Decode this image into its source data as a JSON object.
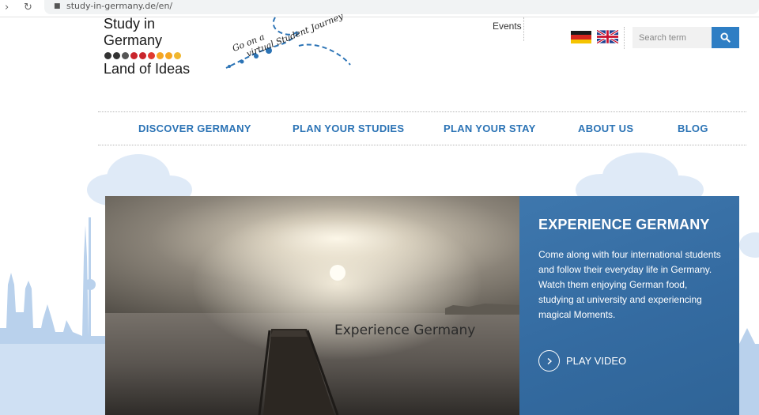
{
  "browser": {
    "url": "study-in-germany.de/en/"
  },
  "logo": {
    "line1": "Study in",
    "line2": "Germany",
    "line3": "Land of Ideas",
    "dot_colors": [
      "#333333",
      "#333333",
      "#555555",
      "#c9252c",
      "#c9252c",
      "#e03a2f",
      "#f5a623",
      "#f5a623",
      "#f0b72f"
    ]
  },
  "journey": {
    "line1": "Go on a",
    "line2": "virtual Student Journey",
    "color": "#2b73b5"
  },
  "header": {
    "events_label": "Events",
    "search_placeholder": "Search term"
  },
  "nav": {
    "items": [
      {
        "label": "DISCOVER GERMANY"
      },
      {
        "label": "PLAN YOUR STUDIES"
      },
      {
        "label": "PLAN YOUR STAY"
      },
      {
        "label": "ABOUT US"
      },
      {
        "label": "BLOG"
      }
    ]
  },
  "hero": {
    "caption": "Experience Germany",
    "title": "EXPERIENCE GERMANY",
    "text": "Come along with four international students and follow their everyday life in Germany. Watch them enjoying German food, studying at university and experiencing magical Moments.",
    "play_label": "PLAY VIDEO"
  },
  "colors": {
    "accent": "#2b73b5",
    "search_button": "#2e7ec4",
    "panel": "#346ba1"
  }
}
